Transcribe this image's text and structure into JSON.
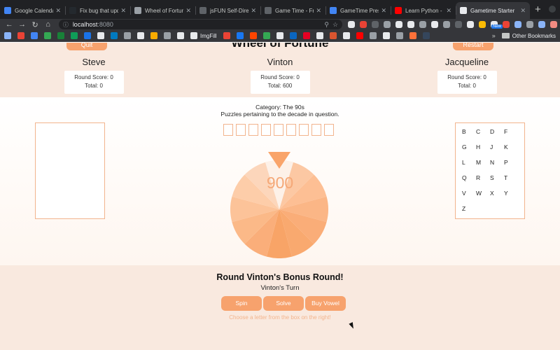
{
  "browser": {
    "tabs": [
      {
        "title": "Google Calendar",
        "favicon_color": "#4285f4",
        "active": false
      },
      {
        "title": "Fix bug that upda",
        "favicon_color": "#24292e",
        "active": false
      },
      {
        "title": "Wheel of Fortune",
        "favicon_color": "#9aa0a6",
        "active": false
      },
      {
        "title": "jsFUN Self-Directe",
        "favicon_color": "#5f6368",
        "active": false
      },
      {
        "title": "Game Time - Fron",
        "favicon_color": "#5f6368",
        "active": false
      },
      {
        "title": "GameTime Presen",
        "favicon_color": "#4285f4",
        "active": false
      },
      {
        "title": "Learn Python - Fu",
        "favicon_color": "#ff0000",
        "active": false
      },
      {
        "title": "Gametime Starter",
        "favicon_color": "#e8eaed",
        "active": true
      }
    ],
    "new_tab_label": "+",
    "url_host": "localhost",
    "url_port": ":8080",
    "new_badge": "New",
    "bookmarks": [
      {
        "icon": "apps-icon",
        "color": "#8ab4f8",
        "label": ""
      },
      {
        "icon": "gmail-icon",
        "color": "#ea4335",
        "label": ""
      },
      {
        "icon": "calendar-icon",
        "color": "#4285f4",
        "label": ""
      },
      {
        "icon": "drive-icon",
        "color": "#34a853",
        "label": ""
      },
      {
        "icon": "plus-icon",
        "color": "#188038",
        "label": ""
      },
      {
        "icon": "sheets-icon",
        "color": "#0f9d58",
        "label": ""
      },
      {
        "icon": "calendar-icon",
        "color": "#1a73e8",
        "label": ""
      },
      {
        "icon": "github-icon",
        "color": "#e8eaed",
        "label": ""
      },
      {
        "icon": "trello-icon",
        "color": "#0079bf",
        "label": ""
      },
      {
        "icon": "circle-icon",
        "color": "#9aa0a6",
        "label": ""
      },
      {
        "icon": "github-icon",
        "color": "#e8eaed",
        "label": ""
      },
      {
        "icon": "bookmark-icon",
        "color": "#f9ab00",
        "label": ""
      },
      {
        "icon": "clock-icon",
        "color": "#9aa0a6",
        "label": ""
      },
      {
        "icon": "doc-icon",
        "color": "#e8eaed",
        "label": ""
      },
      {
        "icon": "imgfill-icon",
        "color": "#e8eaed",
        "label": "ImgFill"
      },
      {
        "icon": "book-icon",
        "color": "#ea4335",
        "label": ""
      },
      {
        "icon": "facebook-icon",
        "color": "#1877f2",
        "label": ""
      },
      {
        "icon": "reddit-icon",
        "color": "#ff4500",
        "label": ""
      },
      {
        "icon": "bitbucket-icon",
        "color": "#34a853",
        "label": ""
      },
      {
        "icon": "slack-icon",
        "color": "#e8eaed",
        "label": ""
      },
      {
        "icon": "linkedin-icon",
        "color": "#0a66c2",
        "label": ""
      },
      {
        "icon": "pinterest-icon",
        "color": "#e60023",
        "label": ""
      },
      {
        "icon": "codepen-icon",
        "color": "#e8eaed",
        "label": ""
      },
      {
        "icon": "product-hunt-icon",
        "color": "#da552f",
        "label": ""
      },
      {
        "icon": "medium-icon",
        "color": "#e8eaed",
        "label": ""
      },
      {
        "icon": "youtube-icon",
        "color": "#ff0000",
        "label": ""
      },
      {
        "icon": "glitch-icon",
        "color": "#9aa0a6",
        "label": ""
      },
      {
        "icon": "flickr-icon",
        "color": "#e8eaed",
        "label": ""
      },
      {
        "icon": "chrome-icon",
        "color": "#9aa0a6",
        "label": ""
      },
      {
        "icon": "firefox-icon",
        "color": "#ff7139",
        "label": ""
      },
      {
        "icon": "tumblr-icon",
        "color": "#35465c",
        "label": ""
      }
    ],
    "more_label": "»",
    "other_bookmarks_label": "Other Bookmarks"
  },
  "header": {
    "left_button": "Quit",
    "right_button": "Restart",
    "title": "Wheel of Fortune",
    "round_score_label": "Round Score:",
    "total_label": "Total:",
    "players": [
      {
        "name": "Steve",
        "round_score": "0",
        "total": "0"
      },
      {
        "name": "Vinton",
        "round_score": "0",
        "total": "600"
      },
      {
        "name": "Jacqueline",
        "round_score": "0",
        "total": "0"
      }
    ]
  },
  "board": {
    "category": "Category: The 90s",
    "hint": "Puzzles pertaining to the decade in question.",
    "puzzle_tiles": [
      "",
      "",
      "",
      "",
      "",
      "",
      "",
      "",
      ""
    ],
    "letters": [
      "B",
      "C",
      "D",
      "F",
      "G",
      "H",
      "J",
      "K",
      "L",
      "M",
      "N",
      "P",
      "Q",
      "R",
      "S",
      "T",
      "V",
      "W",
      "X",
      "Y",
      "Z"
    ],
    "wheel_value": "900",
    "wheel_colors": [
      "#fbd2b5",
      "#fcc8a3",
      "#fdbf94",
      "#fbb686",
      "#faad78",
      "#f9a96f",
      "#f8a467",
      "#faae7a",
      "#fbb988",
      "#fcc399",
      "#fdcda9",
      "#fcd6bb"
    ],
    "pointer_color": "#f9a46a",
    "accent_color": "#f7a26d"
  },
  "footer": {
    "round_title": "Round Vinton's Bonus Round!",
    "turn_text": "Vinton's Turn",
    "buttons": [
      "Spin",
      "Solve",
      "Buy Vowel"
    ],
    "instruction": "Choose a letter from the box on the right!"
  }
}
